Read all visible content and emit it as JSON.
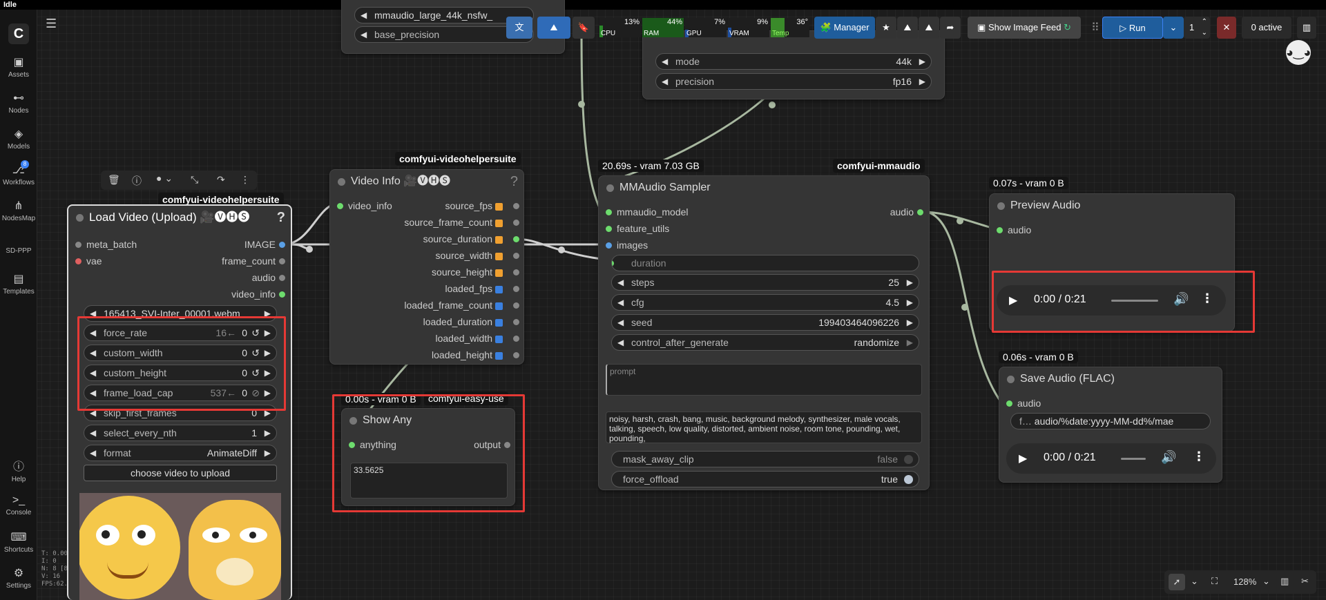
{
  "window": {
    "title": "Idle"
  },
  "sidebar": {
    "items": [
      {
        "label": "Assets",
        "icon": "image-icon"
      },
      {
        "label": "Nodes",
        "icon": "nodes-icon"
      },
      {
        "label": "Models",
        "icon": "models-icon"
      },
      {
        "label": "Workflows",
        "icon": "workflows-icon",
        "badge": "8"
      },
      {
        "label": "NodesMap",
        "icon": "nodesmap-icon"
      },
      {
        "label": "SD-PPP",
        "icon": ""
      },
      {
        "label": "Templates",
        "icon": "templates-icon"
      }
    ],
    "bottom": [
      {
        "label": "Help",
        "icon": "help-icon"
      },
      {
        "label": "Console",
        "icon": "console-icon"
      },
      {
        "label": "Shortcuts",
        "icon": "keyboard-icon"
      },
      {
        "label": "Settings",
        "icon": "gear-icon"
      }
    ]
  },
  "stats": [
    "T: 0.00s",
    "I: 0",
    "N: 8 [8]",
    "V: 16",
    "FPS:62.50"
  ],
  "toolbar": {
    "meters": [
      {
        "label": "CPU",
        "pct": "13%",
        "value": 13
      },
      {
        "label": "RAM",
        "pct": "44%",
        "value": 44
      },
      {
        "label": "GPU",
        "pct": "7%",
        "value": 7
      },
      {
        "label": "VRAM",
        "pct": "9%",
        "value": 9
      },
      {
        "label": "Temp",
        "pct": "36°",
        "value": 36
      }
    ],
    "manager_label": "Manager",
    "show_feed_label": "Show Image Feed",
    "run_label": "Run",
    "run_count": "1",
    "active_label": "0 active"
  },
  "zoom": {
    "level": "128%"
  },
  "nodes": {
    "load_video": {
      "pack": "comfyui-videohelpersuite",
      "title": "Load Video (Upload) 🎥🅥🅗🅢",
      "help": "?",
      "inputs": [
        "meta_batch",
        "vae"
      ],
      "outputs": [
        "IMAGE",
        "frame_count",
        "audio",
        "video_info"
      ],
      "video_file": "165413_SVI-Inter_00001.webm",
      "widgets": [
        {
          "name": "force_rate",
          "hint": "16←",
          "value": "0"
        },
        {
          "name": "custom_width",
          "hint": "",
          "value": "0"
        },
        {
          "name": "custom_height",
          "hint": "",
          "value": "0"
        },
        {
          "name": "frame_load_cap",
          "hint": "537←",
          "value": "0"
        },
        {
          "name": "skip_first_frames",
          "hint": "",
          "value": "0"
        },
        {
          "name": "select_every_nth",
          "hint": "",
          "value": "1"
        },
        {
          "name": "format",
          "hint": "",
          "value": "AnimateDiff"
        }
      ],
      "upload_label": "choose video to upload"
    },
    "video_info": {
      "pack": "comfyui-videohelpersuite",
      "title": "Video Info 🎥🅥🅗🅢",
      "help": "?",
      "input": "video_info",
      "outputs": [
        "source_fps",
        "source_frame_count",
        "source_duration",
        "source_width",
        "source_height",
        "loaded_fps",
        "loaded_frame_count",
        "loaded_duration",
        "loaded_width",
        "loaded_height"
      ]
    },
    "show_any": {
      "pack": "comfyui-easy-use",
      "time": "0.00s - vram 0 B",
      "title": "Show Any",
      "input": "anything",
      "output": "output",
      "value": "33.5625"
    },
    "mmaudio_loader": {
      "model": "mmaudio_large_44k_nsfw_",
      "precision_label": "base_precision"
    },
    "mmaudio_features": {
      "widgets": [
        {
          "name": "mode",
          "value": "44k"
        },
        {
          "name": "precision",
          "value": "fp16"
        }
      ]
    },
    "sampler": {
      "time": "20.69s - vram 7.03 GB",
      "pack": "comfyui-mmaudio",
      "title": "MMAudio Sampler",
      "inputs": [
        "mmaudio_model",
        "feature_utils",
        "images",
        "duration"
      ],
      "output": "audio",
      "widgets": [
        {
          "name": "steps",
          "value": "25"
        },
        {
          "name": "cfg",
          "value": "4.5"
        },
        {
          "name": "seed",
          "value": "199403464096226"
        },
        {
          "name": "control_after_generate",
          "value": "randomize"
        }
      ],
      "prompt_placeholder": "prompt",
      "negative": "noisy, harsh, crash, bang, music, background melody, synthesizer, male vocals, talking, speech, low quality, distorted, ambient noise, room tone, pounding, wet, pounding,",
      "toggles": [
        {
          "name": "mask_away_clip",
          "value": "false"
        },
        {
          "name": "force_offload",
          "value": "true"
        }
      ]
    },
    "preview_audio": {
      "time": "0.07s - vram 0 B",
      "title": "Preview Audio",
      "input": "audio",
      "player_time": "0:00 / 0:21"
    },
    "save_audio": {
      "time": "0.06s - vram 0 B",
      "title": "Save Audio (FLAC)",
      "input": "audio",
      "prefix_label": "f…",
      "prefix": "audio/%date:yyyy-MM-dd%/mae",
      "player_time": "0:00 / 0:21"
    }
  }
}
